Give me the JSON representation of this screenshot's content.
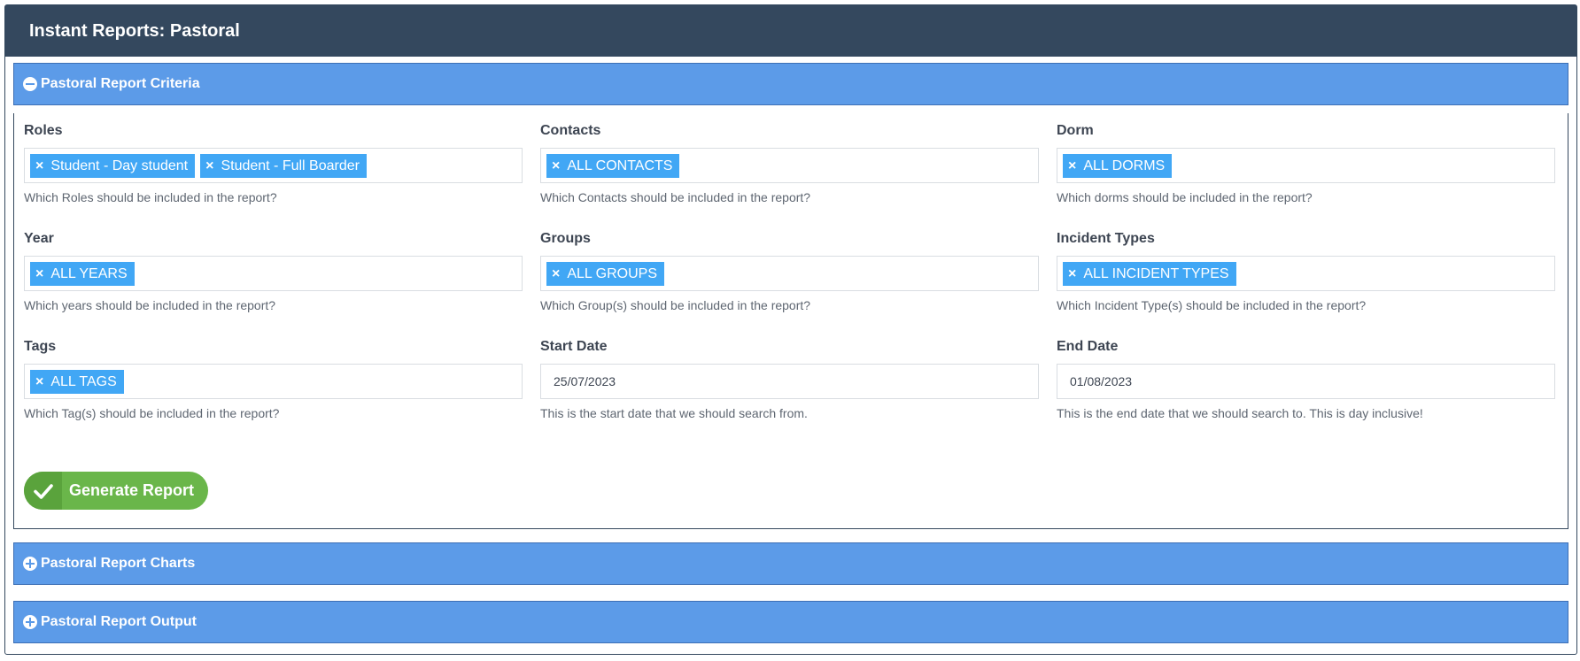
{
  "panel": {
    "title": "Instant Reports: Pastoral"
  },
  "sections": {
    "criteria": {
      "title": "Pastoral Report Criteria",
      "icon": "minus-circle-icon"
    },
    "charts": {
      "title": "Pastoral Report Charts",
      "icon": "plus-circle-icon"
    },
    "output": {
      "title": "Pastoral Report Output",
      "icon": "plus-circle-icon"
    }
  },
  "fields": {
    "roles": {
      "label": "Roles",
      "tags": [
        "Student - Day student",
        "Student - Full Boarder"
      ],
      "help": "Which Roles should be included in the report?"
    },
    "contacts": {
      "label": "Contacts",
      "tags": [
        "ALL CONTACTS"
      ],
      "help": "Which Contacts should be included in the report?"
    },
    "dorm": {
      "label": "Dorm",
      "tags": [
        "ALL DORMS"
      ],
      "help": "Which dorms should be included in the report?"
    },
    "year": {
      "label": "Year",
      "tags": [
        "ALL YEARS"
      ],
      "help": "Which years should be included in the report?"
    },
    "groups": {
      "label": "Groups",
      "tags": [
        "ALL GROUPS"
      ],
      "help": "Which Group(s) should be included in the report?"
    },
    "incident_types": {
      "label": "Incident Types",
      "tags": [
        "ALL INCIDENT TYPES"
      ],
      "help": "Which Incident Type(s) should be included in the report?"
    },
    "tags": {
      "label": "Tags",
      "tags": [
        "ALL TAGS"
      ],
      "help": "Which Tag(s) should be included in the report?"
    },
    "start_date": {
      "label": "Start Date",
      "value": "25/07/2023",
      "help": "This is the start date that we should search from."
    },
    "end_date": {
      "label": "End Date",
      "value": "01/08/2023",
      "help": "This is the end date that we should search to. This is day inclusive!"
    }
  },
  "tag_remove_glyph": "×",
  "generate_button": {
    "label": "Generate Report",
    "icon": "check-icon"
  },
  "colors": {
    "header_bg": "#34485e",
    "section_bg": "#5c9be8",
    "tag_bg": "#41a7f5",
    "button_bg": "#6ab64a"
  }
}
